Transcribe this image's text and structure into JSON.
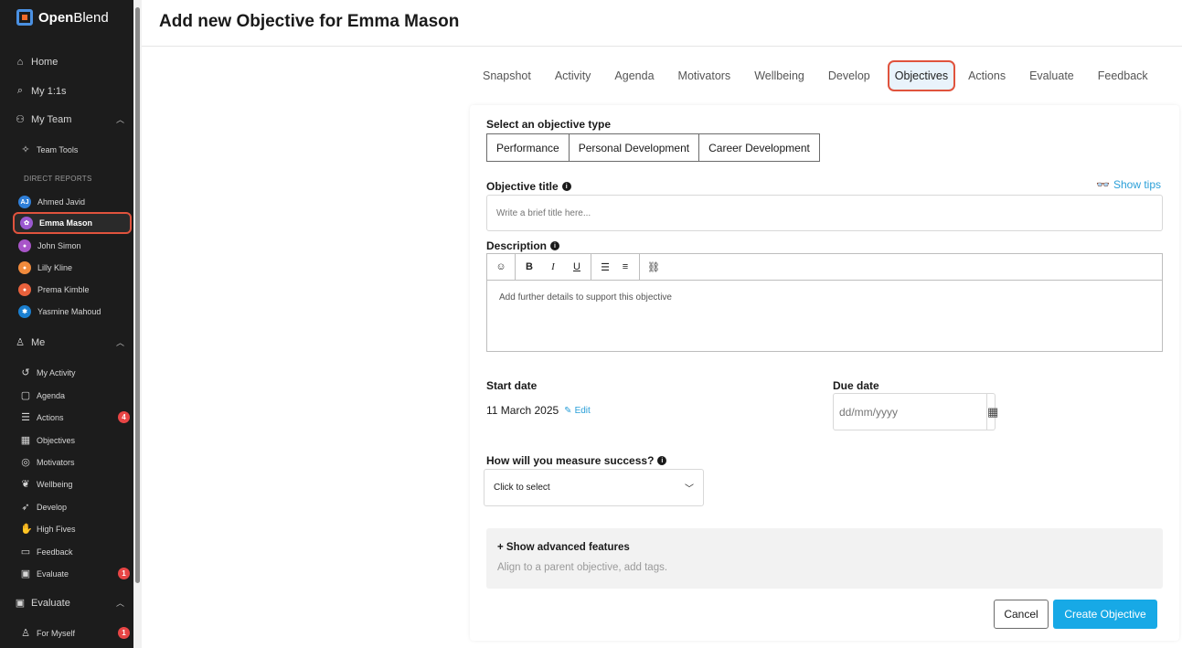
{
  "sidebar": {
    "brand": {
      "strong": "Open",
      "thin": "Blend"
    },
    "home": {
      "icon": "home-icon",
      "label": "Home"
    },
    "one_on_ones": {
      "icon": "chat-icon",
      "label": "My 1:1s"
    },
    "my_team": {
      "icon": "team-icon",
      "label": "My Team"
    },
    "team_tools": {
      "icon": "sparkle-icon",
      "label": "Team Tools"
    },
    "direct_reports_label": "DIRECT REPORTS",
    "reports": [
      {
        "initials": "AJ",
        "name": "Ahmed Javid",
        "color": "#2f7fd8"
      },
      {
        "initials": "",
        "name": "Emma Mason",
        "color": "#9b59d0"
      },
      {
        "initials": "",
        "name": "John Simon",
        "color": "#a855c8"
      },
      {
        "initials": "",
        "name": "Lilly Kline",
        "color": "#f08a3c"
      },
      {
        "initials": "",
        "name": "Prema Kimble",
        "color": "#e8613c"
      },
      {
        "initials": "",
        "name": "Yasmine Mahoud",
        "color": "#1a7fd0"
      }
    ],
    "me": {
      "icon": "user-icon",
      "label": "Me"
    },
    "me_items": [
      {
        "icon": "history-icon",
        "label": "My Activity"
      },
      {
        "icon": "clipboard-icon",
        "label": "Agenda"
      },
      {
        "icon": "checklist-icon",
        "label": "Actions",
        "badge": "4"
      },
      {
        "icon": "objectives-icon",
        "label": "Objectives"
      },
      {
        "icon": "target-icon",
        "label": "Motivators"
      },
      {
        "icon": "leaf-icon",
        "label": "Wellbeing"
      },
      {
        "icon": "rocket-icon",
        "label": "Develop"
      },
      {
        "icon": "high-five-icon",
        "label": "High Fives"
      },
      {
        "icon": "feedback-icon",
        "label": "Feedback"
      },
      {
        "icon": "evaluate-icon",
        "label": "Evaluate",
        "badge": "1"
      }
    ],
    "evaluate": {
      "icon": "evaluate-icon",
      "label": "Evaluate"
    },
    "for_myself": {
      "icon": "person-icon",
      "label": "For Myself",
      "badge": "1"
    }
  },
  "header": {
    "title": "Add new Objective for Emma Mason"
  },
  "tabs": [
    "Snapshot",
    "Activity",
    "Agenda",
    "Motivators",
    "Wellbeing",
    "Develop",
    "Objectives",
    "Actions",
    "Evaluate",
    "Feedback"
  ],
  "active_tab": "Objectives",
  "form": {
    "type_label": "Select an objective type",
    "types": [
      "Performance",
      "Personal Development",
      "Career Development"
    ],
    "title_label": "Objective title",
    "show_tips": "Show tips",
    "title_placeholder": "Write a brief title here...",
    "description_label": "Description",
    "description_placeholder": "Add further details to support this objective",
    "start_label": "Start date",
    "start_value": "11 March 2025",
    "edit_label": "Edit",
    "due_label": "Due date",
    "due_placeholder": "dd/mm/yyyy",
    "measure_label": "How will you measure success?",
    "measure_value": "Click to select",
    "advanced_title": "+ Show advanced features",
    "advanced_sub": "Align to a parent objective, add tags.",
    "cancel": "Cancel",
    "create": "Create Objective"
  }
}
